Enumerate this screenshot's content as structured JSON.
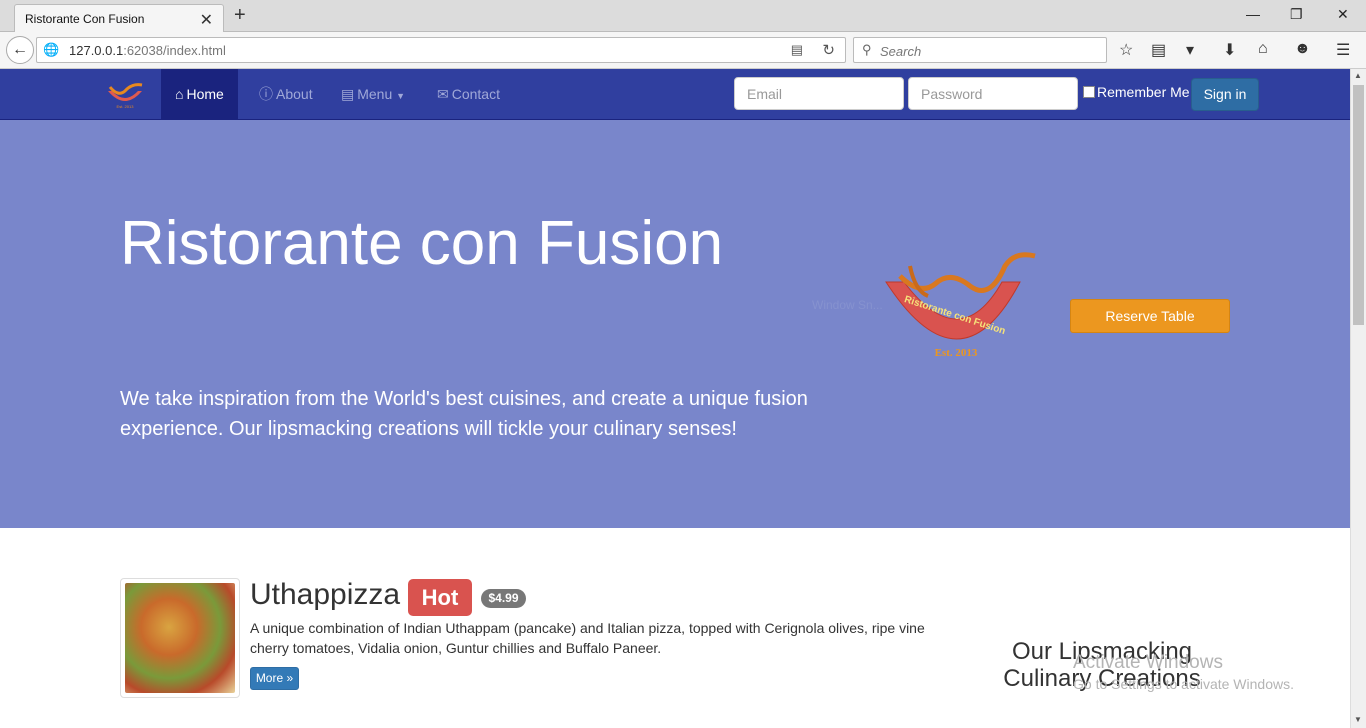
{
  "browser": {
    "tab_title": "Ristorante Con Fusion",
    "tab_close": "✕",
    "new_tab": "+",
    "url_host": "127.0.0.1",
    "url_rest": ":62038/index.html",
    "search_placeholder": "Search"
  },
  "nav": {
    "items": [
      {
        "label": "Home",
        "icon": "home-icon"
      },
      {
        "label": "About",
        "icon": "info-icon"
      },
      {
        "label": "Menu",
        "icon": "list-icon"
      },
      {
        "label": "Contact",
        "icon": "envelope-icon"
      }
    ],
    "email_placeholder": "Email",
    "password_placeholder": "Password",
    "remember_label": "Remember Me",
    "signin_label": "Sign in"
  },
  "jumbotron": {
    "title": "Ristorante con Fusion",
    "text": "We take inspiration from the World's best cuisines, and create a unique fusion experience. Our lipsmacking creations will tickle your culinary senses!",
    "logo_text": "Ristorante con Fusion",
    "logo_est": "Est. 2013",
    "reserve_label": "Reserve Table",
    "watermark_small": "Window Sn..."
  },
  "dish": {
    "name": "Uthappizza",
    "badge": "Hot",
    "price": "$4.99",
    "description": "A unique combination of Indian Uthappam (pancake) and Italian pizza, topped with Cerignola olives, ripe vine cherry tomatoes, Vidalia onion, Guntur chillies and Buffalo Paneer.",
    "more_label": "More »"
  },
  "side": {
    "heading": "Our Lipsmacking Culinary Creations"
  },
  "os_overlay": {
    "line1": "Activate Windows",
    "line2": "Go to Settings to activate Windows."
  },
  "colors": {
    "navbar": "#303F9F",
    "navbar_active": "#1A237E",
    "jumbotron": "#7986CB",
    "reserve": "#EC971F",
    "hot_badge": "#D9534F"
  }
}
